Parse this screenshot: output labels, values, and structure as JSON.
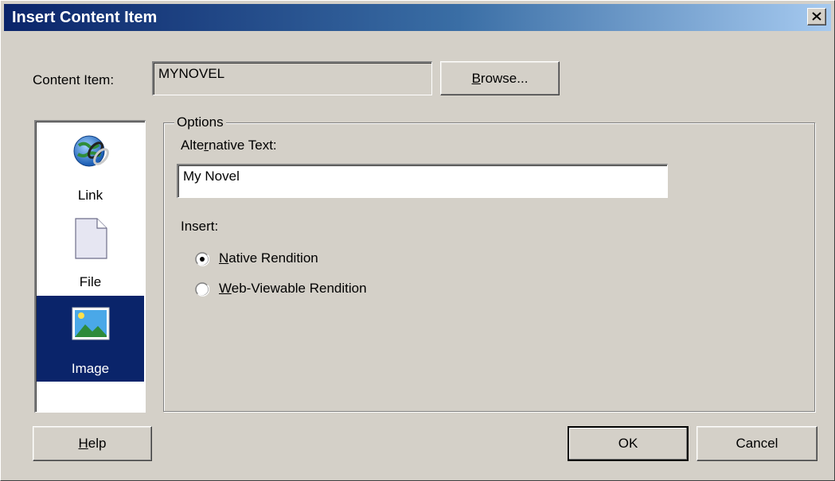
{
  "window": {
    "title": "Insert Content Item"
  },
  "content_item": {
    "label": "Content Item:",
    "value": "MYNOVEL"
  },
  "buttons": {
    "browse": "Browse...",
    "help": "Help",
    "ok": "OK",
    "cancel": "Cancel"
  },
  "types": [
    {
      "label": "Link",
      "icon": "globe-link-icon",
      "selected": false
    },
    {
      "label": "File",
      "icon": "file-icon",
      "selected": false
    },
    {
      "label": "Image",
      "icon": "image-icon",
      "selected": true
    }
  ],
  "options": {
    "legend": "Options",
    "alt_text_label": "Alternative Text:",
    "alt_text_value": "My Novel",
    "insert_label": "Insert:",
    "radios": [
      {
        "label": "Native Rendition",
        "checked": true
      },
      {
        "label": "Web-Viewable Rendition",
        "checked": false
      }
    ]
  },
  "colors": {
    "title_start": "#0a246a",
    "title_end": "#a6caf0",
    "face": "#d4d0c8",
    "selection": "#0a246a"
  }
}
